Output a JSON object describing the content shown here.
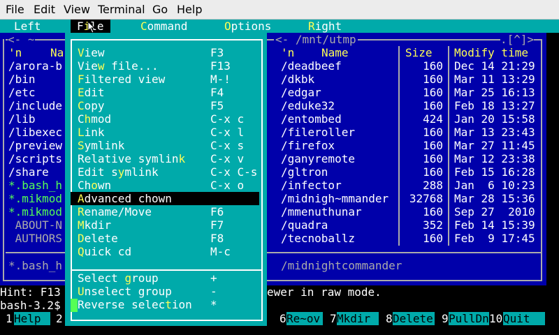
{
  "app_menu": [
    "File",
    "Edit",
    "View",
    "Terminal",
    "Go",
    "Help"
  ],
  "mc_menu": [
    {
      "pre": "",
      "hk": "",
      "label": "Left",
      "key": "left"
    },
    {
      "pre": "F",
      "hk": "i",
      "label": "le",
      "key": "file"
    },
    {
      "pre": "",
      "hk": "C",
      "label": "ommand",
      "key": "command"
    },
    {
      "pre": "",
      "hk": "O",
      "label": "ptions",
      "key": "options"
    },
    {
      "pre": "",
      "hk": "R",
      "label": "ight",
      "key": "right"
    }
  ],
  "left_panel": {
    "title": "<- ~",
    "header_n": "'n",
    "header_name": "Na",
    "rows": [
      {
        "text": "/arora-b",
        "color": "white"
      },
      {
        "text": "/bin",
        "color": "white"
      },
      {
        "text": "/etc",
        "color": "white"
      },
      {
        "text": "/include",
        "color": "white"
      },
      {
        "text": "/lib",
        "color": "white"
      },
      {
        "text": "/libexec",
        "color": "white"
      },
      {
        "text": "/preview",
        "color": "white"
      },
      {
        "text": "/scripts",
        "color": "white"
      },
      {
        "text": "/share",
        "color": "white"
      },
      {
        "text": "*.bash_h",
        "color": "green"
      },
      {
        "text": "*.mikmod",
        "color": "green"
      },
      {
        "text": "*.mikmod",
        "color": "green"
      },
      {
        "text": " ABOUT-N",
        "color": "gray"
      },
      {
        "text": " AUTHORS",
        "color": "gray"
      }
    ],
    "footer": "*.bash_h"
  },
  "right_panel": {
    "title": "<- /mnt/utmp",
    "indicator": ".[^]>",
    "headers": {
      "n": "'n",
      "name": "Name",
      "size": "Size",
      "time": "Modify time"
    },
    "rows": [
      {
        "name": "/deadbeef",
        "size": "160",
        "date": "Dec 14 21:29"
      },
      {
        "name": "/dkbk",
        "size": "160",
        "date": "Mar 11 13:29"
      },
      {
        "name": "/edgar",
        "size": "160",
        "date": "Mar 25 16:13"
      },
      {
        "name": "/eduke32",
        "size": "160",
        "date": "Feb 18 13:27"
      },
      {
        "name": "/entombed",
        "size": "424",
        "date": "Jan 20 15:58"
      },
      {
        "name": "/fileroller",
        "size": "160",
        "date": "Mar 13 23:43"
      },
      {
        "name": "/firefox",
        "size": "160",
        "date": "Mar 27 11:45"
      },
      {
        "name": "/ganyremote",
        "size": "160",
        "date": "Mar 12 23:38"
      },
      {
        "name": "/gltron",
        "size": "160",
        "date": "Feb 15 16:28"
      },
      {
        "name": "/infector",
        "size": "288",
        "date": "Jan  6 10:23"
      },
      {
        "name": "/midnigh~mmander",
        "size": "32768",
        "date": "Mar 28 15:36"
      },
      {
        "name": "/mmenuthunar",
        "size": "160",
        "date": "Sep 27  2010"
      },
      {
        "name": "/quadra",
        "size": "352",
        "date": "Feb 14 15:39"
      },
      {
        "name": "/tecnoballz",
        "size": "160",
        "date": "Feb  9 17:45"
      }
    ],
    "footer": "/midnightcommander"
  },
  "file_menu": [
    {
      "pre": "",
      "hk": "V",
      "post": "iew",
      "shortcut": "F3"
    },
    {
      "pre": "Vie",
      "hk": "w",
      "post": " file...",
      "shortcut": "F13"
    },
    {
      "pre": "",
      "hk": "F",
      "post": "iltered view",
      "shortcut": "M-!"
    },
    {
      "pre": "",
      "hk": "E",
      "post": "dit",
      "shortcut": "F4"
    },
    {
      "pre": "",
      "hk": "C",
      "post": "opy",
      "shortcut": "F5"
    },
    {
      "pre": "C",
      "hk": "h",
      "post": "mod",
      "shortcut": "C-x c"
    },
    {
      "pre": "",
      "hk": "L",
      "post": "ink",
      "shortcut": "C-x l"
    },
    {
      "pre": "",
      "hk": "S",
      "post": "ymlink",
      "shortcut": "C-x s"
    },
    {
      "pre": "Relative symlin",
      "hk": "k",
      "post": "",
      "shortcut": "C-x v"
    },
    {
      "pre": "Edit s",
      "hk": "y",
      "post": "mlink",
      "shortcut": "C-x C-s"
    },
    {
      "pre": "Ch",
      "hk": "o",
      "post": "wn",
      "shortcut": "C-x o"
    },
    {
      "pre": "",
      "hk": "A",
      "post": "dvanced chown",
      "shortcut": "",
      "selected": true
    },
    {
      "pre": "",
      "hk": "R",
      "post": "ename/Move",
      "shortcut": "F6"
    },
    {
      "pre": "",
      "hk": "M",
      "post": "kdir",
      "shortcut": "F7"
    },
    {
      "pre": "",
      "hk": "D",
      "post": "elete",
      "shortcut": "F8"
    },
    {
      "pre": "",
      "hk": "Q",
      "post": "uick cd",
      "shortcut": "M-c"
    },
    {
      "separator": true
    },
    {
      "pre": "Select ",
      "hk": "g",
      "post": "roup",
      "shortcut": "+"
    },
    {
      "pre": "",
      "hk": "U",
      "post": "nselect group",
      "shortcut": "-"
    },
    {
      "pre": "Reverse selec",
      "hk": "t",
      "post": "ion",
      "shortcut": "*"
    }
  ],
  "hint_left": "Hint: F13",
  "hint_right": "ewer in raw mode.",
  "prompt": "bash-3.2$",
  "fkeys": [
    {
      "num": "1",
      "label": "Help"
    },
    {
      "num": "2",
      "label": ""
    },
    {
      "num": "6",
      "label": "Re~ov"
    },
    {
      "num": "7",
      "label": "Mkdir"
    },
    {
      "num": "8",
      "label": "Delete"
    },
    {
      "num": "9",
      "label": "PullDn"
    },
    {
      "num": "10",
      "label": "Quit"
    }
  ]
}
